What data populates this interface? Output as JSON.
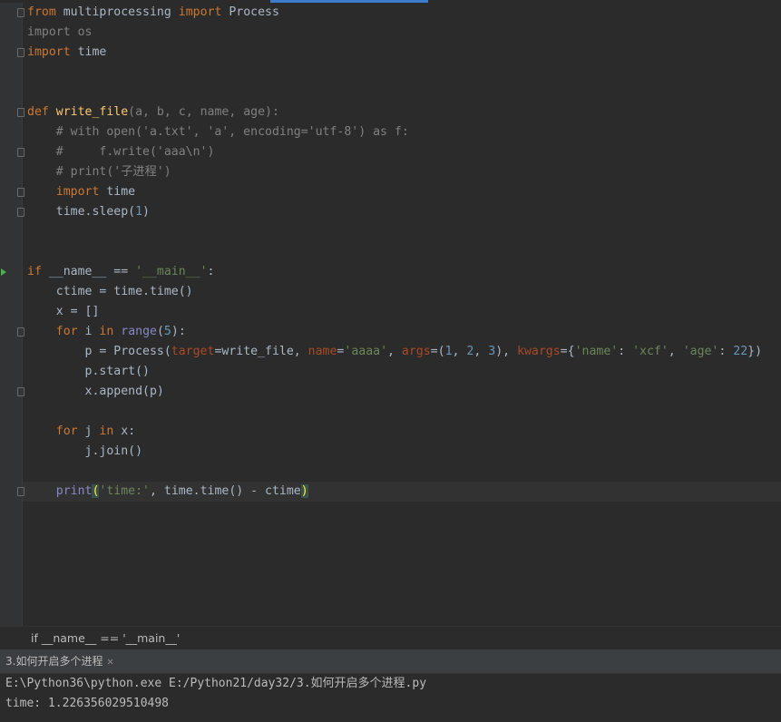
{
  "editor": {
    "lines": [
      [
        {
          "t": "from",
          "c": "kw"
        },
        {
          "t": " multiprocessing ",
          "c": ""
        },
        {
          "t": "import",
          "c": "kw"
        },
        {
          "t": " Process",
          "c": ""
        }
      ],
      [
        {
          "t": "import os",
          "c": "gray"
        }
      ],
      [
        {
          "t": "import",
          "c": "kw"
        },
        {
          "t": " time",
          "c": ""
        }
      ],
      [],
      [],
      [
        {
          "t": "def ",
          "c": "kw"
        },
        {
          "t": "write_file",
          "c": "fn"
        },
        {
          "t": "(a, b, c, name, age):",
          "c": "gray"
        }
      ],
      [
        {
          "t": "    # with open('a.txt', 'a', encoding='utf-8') as f:",
          "c": "cmt"
        }
      ],
      [
        {
          "t": "    #     f.write('aaa\\n')",
          "c": "cmt"
        }
      ],
      [
        {
          "t": "    # print('子进程')",
          "c": "cmt"
        }
      ],
      [
        {
          "t": "    ",
          "c": ""
        },
        {
          "t": "import",
          "c": "kw"
        },
        {
          "t": " time",
          "c": ""
        }
      ],
      [
        {
          "t": "    time.sleep(",
          "c": ""
        },
        {
          "t": "1",
          "c": "num"
        },
        {
          "t": ")",
          "c": ""
        }
      ],
      [],
      [],
      [
        {
          "t": "if",
          "c": "kw"
        },
        {
          "t": " __name__ == ",
          "c": ""
        },
        {
          "t": "'__main__'",
          "c": "str"
        },
        {
          "t": ":",
          "c": ""
        }
      ],
      [
        {
          "t": "    ctime = time.time()",
          "c": ""
        }
      ],
      [
        {
          "t": "    x = []",
          "c": ""
        }
      ],
      [
        {
          "t": "    ",
          "c": ""
        },
        {
          "t": "for",
          "c": "kw"
        },
        {
          "t": " i ",
          "c": ""
        },
        {
          "t": "in",
          "c": "kw"
        },
        {
          "t": " ",
          "c": ""
        },
        {
          "t": "range",
          "c": "bi"
        },
        {
          "t": "(",
          "c": ""
        },
        {
          "t": "5",
          "c": "num"
        },
        {
          "t": "):",
          "c": ""
        }
      ],
      [
        {
          "t": "        p = Process(",
          "c": ""
        },
        {
          "t": "target",
          "c": "prm"
        },
        {
          "t": "=write_file, ",
          "c": ""
        },
        {
          "t": "name",
          "c": "prm"
        },
        {
          "t": "=",
          "c": ""
        },
        {
          "t": "'aaaa'",
          "c": "str"
        },
        {
          "t": ", ",
          "c": ""
        },
        {
          "t": "args",
          "c": "prm"
        },
        {
          "t": "=(",
          "c": ""
        },
        {
          "t": "1",
          "c": "num"
        },
        {
          "t": ", ",
          "c": ""
        },
        {
          "t": "2",
          "c": "num"
        },
        {
          "t": ", ",
          "c": ""
        },
        {
          "t": "3",
          "c": "num"
        },
        {
          "t": "), ",
          "c": ""
        },
        {
          "t": "kwargs",
          "c": "prm"
        },
        {
          "t": "={",
          "c": ""
        },
        {
          "t": "'name'",
          "c": "str"
        },
        {
          "t": ": ",
          "c": ""
        },
        {
          "t": "'xcf'",
          "c": "str"
        },
        {
          "t": ", ",
          "c": ""
        },
        {
          "t": "'age'",
          "c": "str"
        },
        {
          "t": ": ",
          "c": ""
        },
        {
          "t": "22",
          "c": "num"
        },
        {
          "t": "})",
          "c": ""
        }
      ],
      [
        {
          "t": "        p.start()",
          "c": ""
        }
      ],
      [
        {
          "t": "        x.append(p)",
          "c": ""
        }
      ],
      [],
      [
        {
          "t": "    ",
          "c": ""
        },
        {
          "t": "for",
          "c": "kw"
        },
        {
          "t": " j ",
          "c": ""
        },
        {
          "t": "in",
          "c": "kw"
        },
        {
          "t": " x:",
          "c": ""
        }
      ],
      [
        {
          "t": "        j.join()",
          "c": ""
        }
      ],
      [],
      [
        {
          "t": "    ",
          "c": ""
        },
        {
          "t": "print",
          "c": "bi"
        },
        {
          "t": "(",
          "c": "paren"
        },
        {
          "t": "'time:'",
          "c": "str"
        },
        {
          "t": ", time.time() - ctime",
          "c": ""
        },
        {
          "t": ")",
          "c": "paren"
        }
      ]
    ],
    "fold_markers_on_lines": [
      0,
      2,
      5,
      7,
      9,
      10,
      16,
      19,
      24
    ],
    "run_marker_line": 13,
    "current_line": 24,
    "colors": {
      "keyword": "#cc7832",
      "function": "#ffc66d",
      "param": "#aa4926",
      "string": "#6a8759",
      "number": "#6897bb",
      "comment": "#808080",
      "builtin": "#8888c6",
      "default": "#a9b7c6"
    }
  },
  "breadcrumb": {
    "text": "if __name__ == '__main__'"
  },
  "run_panel": {
    "tab_label": "3.如何开启多个进程",
    "close_icon": "close-icon",
    "console_lines": [
      "E:\\Python36\\python.exe E:/Python21/day32/3.如何开启多个进程.py",
      "time: 1.226356029510498"
    ]
  }
}
